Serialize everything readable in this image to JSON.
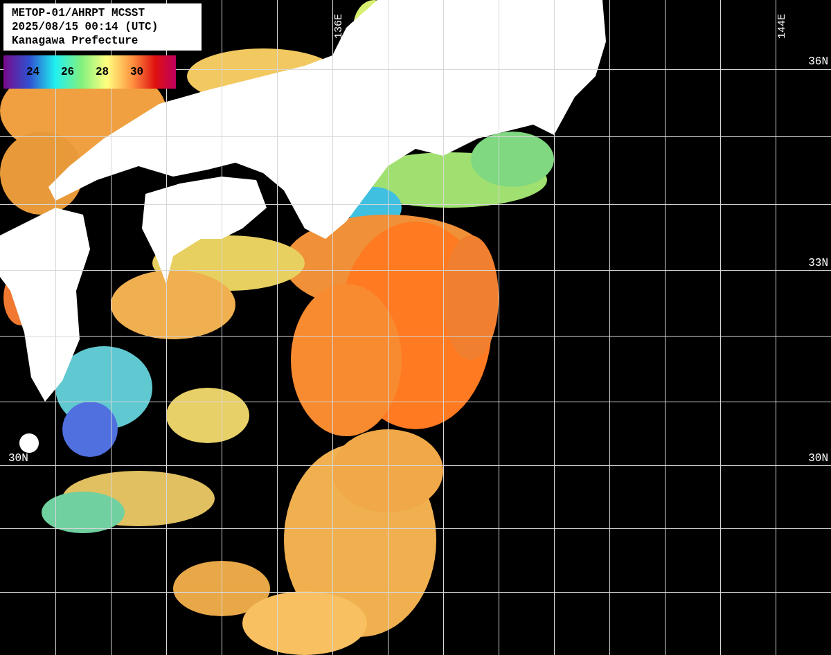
{
  "title_lines": [
    "METOP-01/AHRPT MCSST",
    "2025/08/15 00:14 (UTC)",
    "Kanagawa Prefecture"
  ],
  "legend": {
    "ticks": [
      "24",
      "26",
      "28",
      "30"
    ]
  },
  "longitude_labels": [
    "136E",
    "144E"
  ],
  "left_latitude_labels": [
    "30N"
  ],
  "right_latitude_labels": [
    "36N",
    "33N",
    "30N"
  ]
}
